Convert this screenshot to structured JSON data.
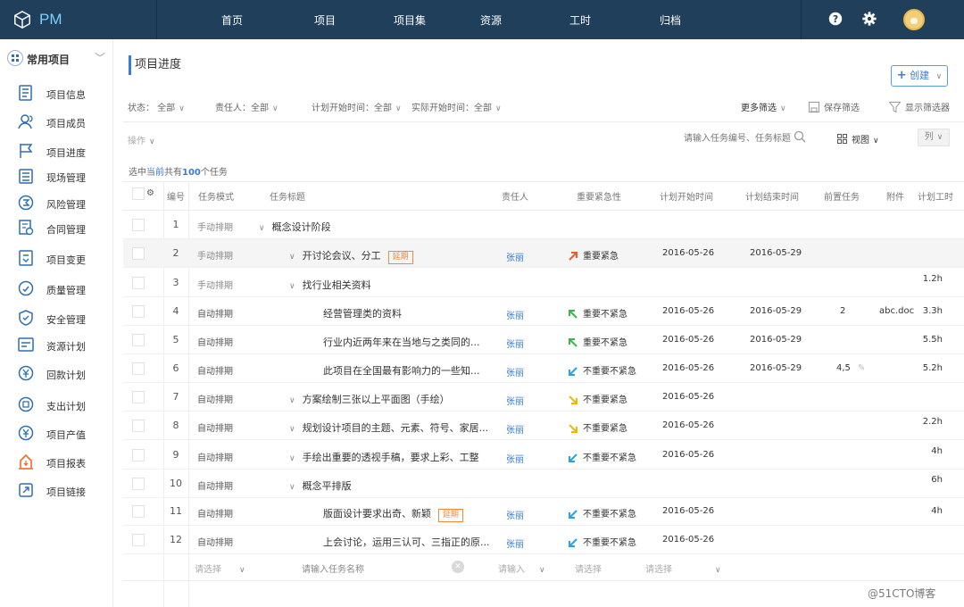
{
  "brand": {
    "name": "PM"
  },
  "nav": [
    "首页",
    "项目",
    "项目集",
    "资源",
    "工时",
    "归档"
  ],
  "sidebar": {
    "header": "常用项目",
    "items": [
      "项目信息",
      "项目成员",
      "项目进度",
      "现场管理",
      "风险管理",
      "合同管理",
      "项目变更",
      "质量管理",
      "安全管理",
      "资源计划",
      "回款计划",
      "支出计划",
      "项目产值",
      "项目报表",
      "项目链接"
    ]
  },
  "page": {
    "title": "项目进度",
    "create_label": "创建"
  },
  "filters": {
    "status": "状态：  全部",
    "owner": "责任人：全部",
    "plan_start": "计划开始时间：全部",
    "actual_start": "实际开始时间：全部",
    "more": "更多筛选",
    "save": "保存筛选",
    "show": "显示筛选器"
  },
  "toolbar": {
    "ops": "操作",
    "search_placeholder": "请输入任务编号、任务标题",
    "view": "视图",
    "columns": "列"
  },
  "summary": {
    "prefix": "选中",
    "current": "当前",
    "middle": "共有",
    "count": "100",
    "suffix": "个任务"
  },
  "columns": [
    "编号",
    "任务模式",
    "任务标题",
    "责任人",
    "重要紧急性",
    "计划开始时间",
    "计划结束时间",
    "前置任务",
    "附件",
    "计划工时"
  ],
  "rows": [
    {
      "id": "1",
      "mode": "手动排期",
      "title": "概念设计阶段",
      "indent": 0,
      "caret": true,
      "delay": "",
      "owner": "",
      "priority": "",
      "pri_type": "",
      "start": "",
      "end": "",
      "pred": "",
      "attach": "",
      "hours": ""
    },
    {
      "id": "2",
      "mode": "手动排期",
      "title": "开讨论会议、分工",
      "indent": 1,
      "caret": true,
      "delay": "延期",
      "owner": "张丽",
      "priority": "重要紧急",
      "pri_type": "ur",
      "start": "2016-05-26",
      "end": "2016-05-29",
      "pred": "",
      "attach": "",
      "hours": ""
    },
    {
      "id": "3",
      "mode": "手动排期",
      "title": "找行业相关资料",
      "indent": 1,
      "caret": true,
      "delay": "",
      "owner": "",
      "priority": "",
      "pri_type": "",
      "start": "",
      "end": "",
      "pred": "",
      "attach": "",
      "hours": "1.2h"
    },
    {
      "id": "4",
      "mode": "自动排期",
      "title": "经营管理类的资料",
      "indent": 2,
      "caret": false,
      "delay": "",
      "owner": "张丽",
      "priority": "重要不紧急",
      "pri_type": "ul",
      "start": "2016-05-26",
      "end": "2016-05-29",
      "pred": "2",
      "attach": "abc.doc",
      "hours": "3.3h"
    },
    {
      "id": "5",
      "mode": "自动排期",
      "title": "行业内近两年来在当地与之类同的...",
      "indent": 2,
      "caret": false,
      "delay": "",
      "owner": "张丽",
      "priority": "重要不紧急",
      "pri_type": "ul",
      "start": "2016-05-26",
      "end": "2016-05-29",
      "pred": "",
      "attach": "",
      "hours": "5.5h"
    },
    {
      "id": "6",
      "mode": "自动排期",
      "title": "此项目在全国最有影响力的一些知...",
      "indent": 2,
      "caret": false,
      "delay": "",
      "owner": "张丽",
      "priority": "不重要不紧急",
      "pri_type": "dl",
      "start": "2016-05-26",
      "end": "2016-05-29",
      "pred": "4,5",
      "attach": "",
      "hours": "5.2h"
    },
    {
      "id": "7",
      "mode": "自动排期",
      "title": "方案绘制三张以上平面图（手绘）",
      "indent": 1,
      "caret": true,
      "delay": "",
      "owner": "张丽",
      "priority": "不重要紧急",
      "pri_type": "dr",
      "start": "2016-05-26",
      "end": "",
      "pred": "",
      "attach": "",
      "hours": ""
    },
    {
      "id": "8",
      "mode": "自动排期",
      "title": "规划设计项目的主题、元素、符号、家居...",
      "indent": 1,
      "caret": true,
      "delay": "",
      "owner": "张丽",
      "priority": "不重要紧急",
      "pri_type": "dr",
      "start": "2016-05-26",
      "end": "",
      "pred": "",
      "attach": "",
      "hours": "2.2h"
    },
    {
      "id": "9",
      "mode": "自动排期",
      "title": "手绘出重要的透视手稿，要求上彩、工整",
      "indent": 1,
      "caret": true,
      "delay": "",
      "owner": "张丽",
      "priority": "不重要不紧急",
      "pri_type": "dl",
      "start": "2016-05-26",
      "end": "",
      "pred": "",
      "attach": "",
      "hours": "4h"
    },
    {
      "id": "10",
      "mode": "自动排期",
      "title": "概念平排版",
      "indent": 1,
      "caret": true,
      "delay": "",
      "owner": "",
      "priority": "",
      "pri_type": "",
      "start": "",
      "end": "",
      "pred": "",
      "attach": "",
      "hours": "6h"
    },
    {
      "id": "11",
      "mode": "自动排期",
      "title": "版面设计要求出奇、新颖",
      "indent": 2,
      "caret": false,
      "delay": "延期",
      "owner": "张丽",
      "priority": "不重要不紧急",
      "pri_type": "dl",
      "start": "2016-05-26",
      "end": "",
      "pred": "",
      "attach": "",
      "hours": "4h"
    },
    {
      "id": "12",
      "mode": "自动排期",
      "title": "上会讨论，运用三认可、三指正的原...",
      "indent": 2,
      "caret": false,
      "delay": "",
      "owner": "张丽",
      "priority": "不重要不紧急",
      "pri_type": "dl",
      "start": "2016-05-26",
      "end": "",
      "pred": "",
      "attach": "",
      "hours": ""
    }
  ],
  "new_row": {
    "mode_placeholder": "请选择",
    "title_placeholder": "请输入任务名称",
    "owner_placeholder": "请输入",
    "priority_placeholder": "请选择",
    "date_placeholder": "请选择"
  },
  "watermark": "@51CTO博客",
  "colors": {
    "topbar": "#1f3f5b",
    "accent": "#3a7bd5",
    "delay": "#f08a3c",
    "pri_red": "#f05a28",
    "pri_green": "#3bb54a",
    "pri_blue": "#28a0e6",
    "pri_yellow": "#f2b600"
  }
}
